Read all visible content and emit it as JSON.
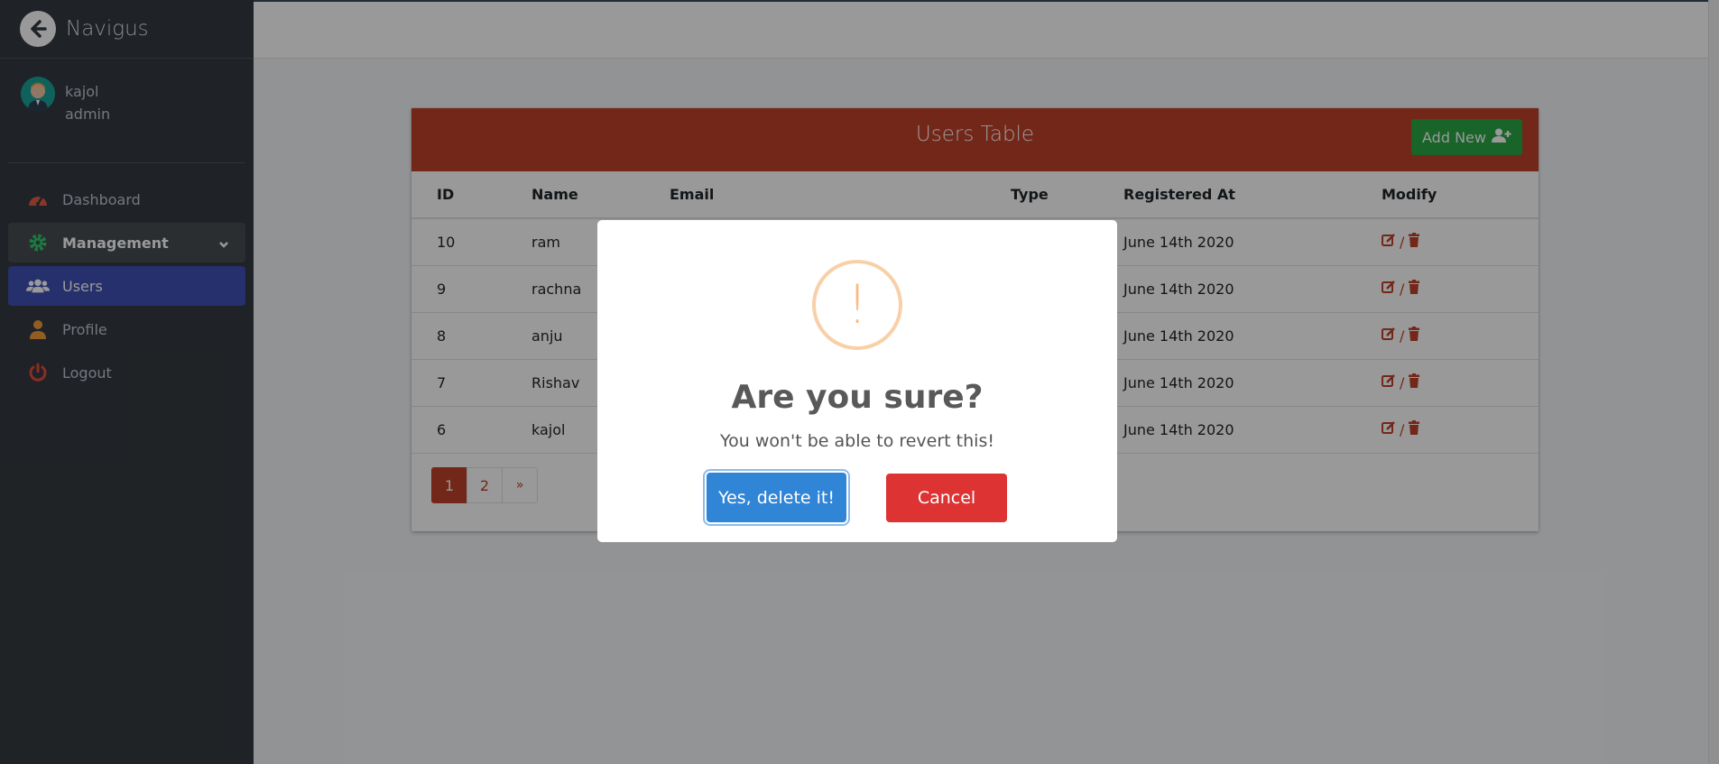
{
  "brand": {
    "name": "Navigus"
  },
  "user": {
    "name": "kajol",
    "role": "admin"
  },
  "nav": {
    "dashboard": "Dashboard",
    "management": "Management",
    "users": "Users",
    "profile": "Profile",
    "logout": "Logout"
  },
  "card": {
    "title": "Users Table",
    "add_new": "Add New"
  },
  "table": {
    "headers": [
      "ID",
      "Name",
      "Email",
      "Type",
      "Registered At",
      "Modify"
    ],
    "rows": [
      {
        "id": "10",
        "name": "ram",
        "registered": "June 14th 2020"
      },
      {
        "id": "9",
        "name": "rachna",
        "registered": "June 14th 2020"
      },
      {
        "id": "8",
        "name": "anju",
        "registered": "June 14th 2020"
      },
      {
        "id": "7",
        "name": "Rishav",
        "registered": "June 14th 2020"
      },
      {
        "id": "6",
        "name": "kajol",
        "registered": "June 14th 2020"
      }
    ],
    "modify_separator": "/"
  },
  "pagination": {
    "pages": [
      "1",
      "2"
    ],
    "next": "»",
    "current": "1"
  },
  "modal": {
    "icon": "!",
    "title": "Are you sure?",
    "text": "You won't be able to revert this!",
    "confirm": "Yes, delete it!",
    "cancel": "Cancel"
  },
  "colors": {
    "sidebar": "#343a40",
    "header": "#c0422b",
    "accent": "#3f51b5",
    "success": "#28a745",
    "confirm": "#3085d6",
    "cancel": "#dd3333",
    "warning": "#f8bb86"
  },
  "icons": {
    "brand": "arrow-left-circle-icon",
    "dashboard": "tachometer-icon",
    "management": "gear-icon",
    "users": "users-icon",
    "profile": "user-icon",
    "logout": "power-icon",
    "edit": "edit-icon",
    "delete": "trash-icon"
  }
}
